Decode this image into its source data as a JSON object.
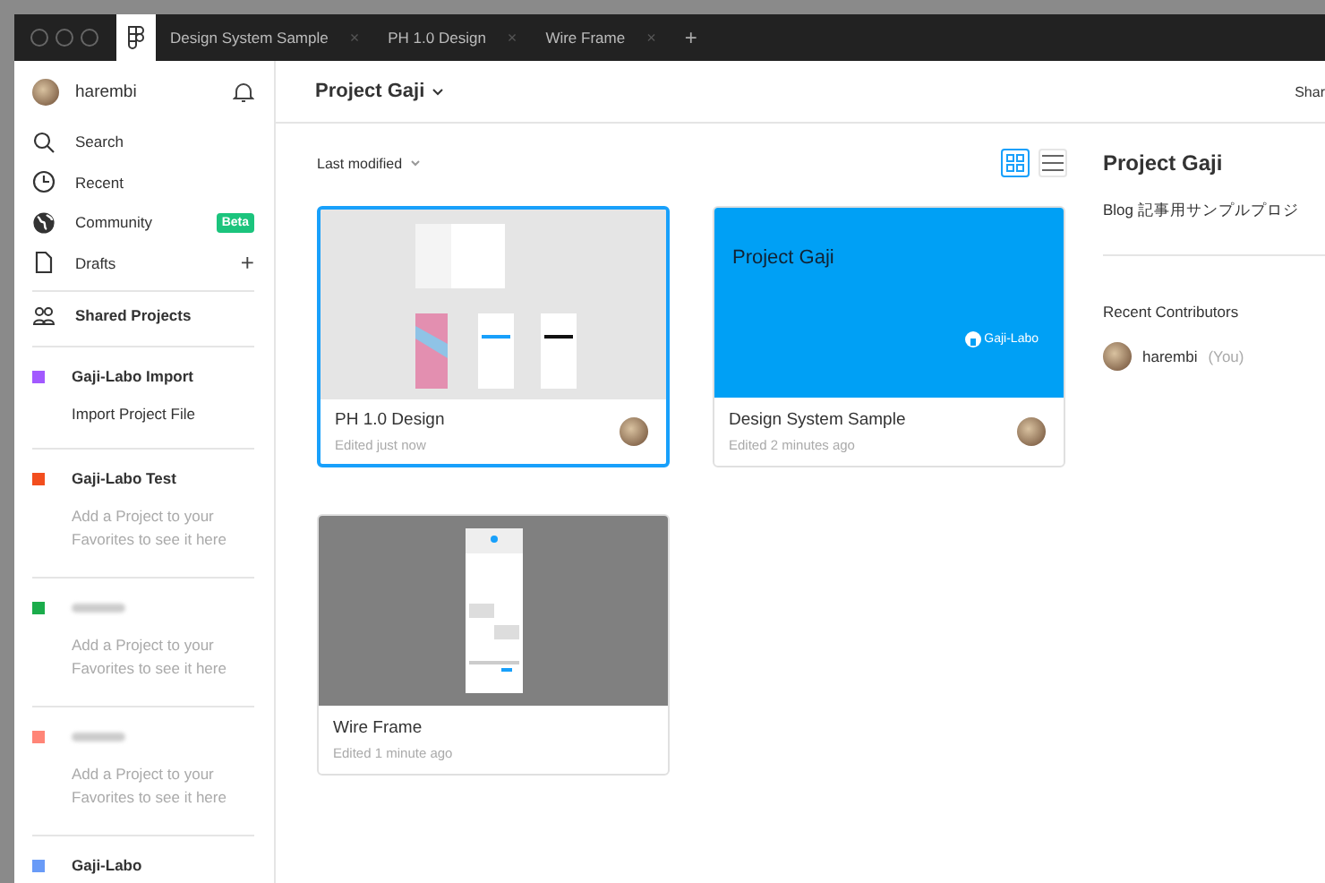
{
  "tabs": [
    {
      "kind": "home",
      "selected": true
    },
    {
      "kind": "file",
      "label": "Design System Sample",
      "close": "×",
      "selected": false
    },
    {
      "kind": "file",
      "label": "PH 1.0 Design",
      "close": "×",
      "selected": false
    },
    {
      "kind": "file",
      "label": "Wire Frame",
      "close": "×",
      "selected": false
    },
    {
      "kind": "add",
      "label": "+",
      "selected": false
    }
  ],
  "user": {
    "name": "harembi"
  },
  "nav": [
    {
      "kind": "search",
      "label": "Search"
    },
    {
      "kind": "recent",
      "label": "Recent"
    },
    {
      "kind": "community",
      "label": "Community",
      "badge": "Beta"
    },
    {
      "kind": "drafts",
      "label": "Drafts",
      "action": "+"
    }
  ],
  "shared": {
    "label": "Shared Projects"
  },
  "teams": [
    {
      "name": "Gaji-Labo Import",
      "color": "#a259ff",
      "link": "Import Project File"
    },
    {
      "name": "Gaji-Labo Test",
      "color": "#f24e1e",
      "hint": "Add a Project to your Favorites to see it here"
    },
    {
      "redacted": true,
      "color": "#1bac4b",
      "hint": "Add a Project to your Favorites to see it here"
    },
    {
      "redacted": true,
      "color": "#ff8577",
      "hint": "Add a Project to your Favorites to see it here"
    },
    {
      "name": "Gaji-Labo",
      "color": "#699bf7"
    }
  ],
  "header": {
    "title": "Project Gaji",
    "share": "Shar"
  },
  "sort": {
    "label": "Last modified"
  },
  "view": [
    {
      "kind": "grid",
      "selected": true
    },
    {
      "kind": "list",
      "selected": false
    }
  ],
  "files": [
    {
      "kind": "design",
      "title": "PH 1.0 Design",
      "edited": "Edited just now",
      "selected": true,
      "avatar": true
    },
    {
      "kind": "cover",
      "title": "Design System Sample",
      "edited": "Edited 2 minutes ago",
      "selected": false,
      "avatar": true,
      "cover_title": "Project Gaji",
      "cover_logo": "Gaji-Labo"
    },
    {
      "kind": "wire",
      "title": "Wire Frame",
      "edited": "Edited 1 minute ago",
      "selected": false,
      "avatar": false
    }
  ],
  "panel": {
    "title": "Project Gaji",
    "description": "Blog 記事用サンプルプロジ",
    "contributors_title": "Recent Contributors",
    "contributors": [
      {
        "name": "harembi",
        "note": "(You)"
      }
    ]
  }
}
